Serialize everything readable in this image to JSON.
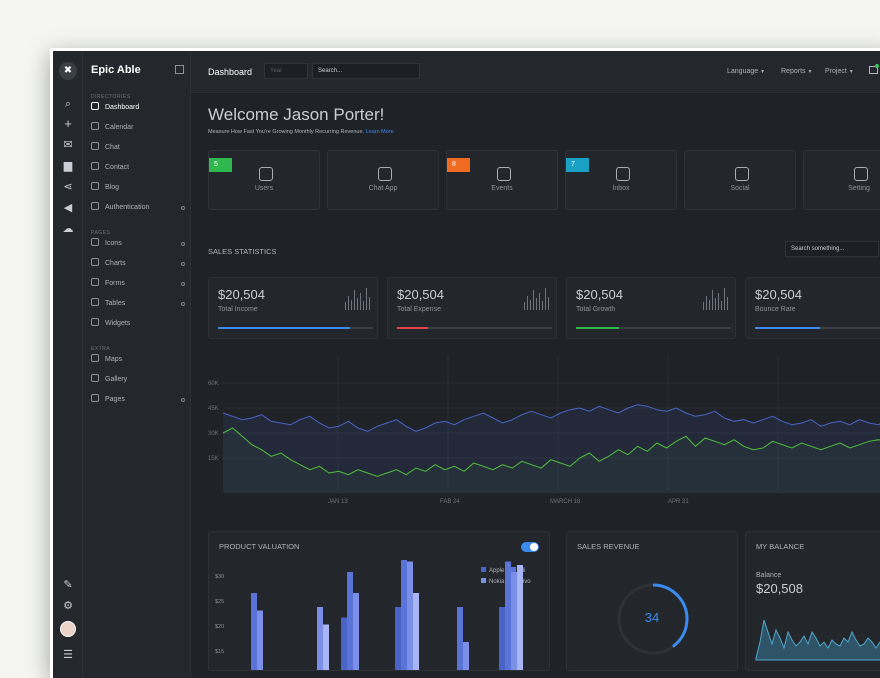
{
  "app": {
    "brand": "Epic Able"
  },
  "sidebar": {
    "sections": [
      {
        "title": "DIRECTORIES",
        "items": [
          {
            "label": "Dashboard",
            "active": true,
            "icon": "home-icon"
          },
          {
            "label": "Calendar",
            "icon": "calendar-icon"
          },
          {
            "label": "Chat",
            "icon": "chat-icon"
          },
          {
            "label": "Contact",
            "icon": "contact-icon"
          },
          {
            "label": "Blog",
            "icon": "globe-icon"
          },
          {
            "label": "Authentication",
            "icon": "lock-icon",
            "sub": true
          }
        ]
      },
      {
        "title": "PAGES",
        "items": [
          {
            "label": "Icons",
            "icon": "tag-icon",
            "sub": true
          },
          {
            "label": "Charts",
            "icon": "bar-chart-icon",
            "sub": true
          },
          {
            "label": "Forms",
            "icon": "forms-icon",
            "sub": true
          },
          {
            "label": "Tables",
            "icon": "table-icon",
            "sub": true
          },
          {
            "label": "Widgets",
            "icon": "widget-icon"
          }
        ]
      },
      {
        "title": "EXTRA",
        "items": [
          {
            "label": "Maps",
            "icon": "map-icon"
          },
          {
            "label": "Gallery",
            "icon": "image-icon"
          },
          {
            "label": "Pages",
            "icon": "page-icon",
            "sub": true
          }
        ]
      }
    ]
  },
  "topbar": {
    "title": "Dashboard",
    "year_placeholder": "Year",
    "search_value": "Search...",
    "menus": [
      "Language",
      "Reports",
      "Project"
    ]
  },
  "welcome": {
    "title": "Welcome Jason Porter!",
    "subtitle": "Measure How Fast You're Growing Monthly Recurring Revenue.",
    "link": "Learn More"
  },
  "cards": [
    {
      "label": "Users",
      "badge": "5",
      "badge_color": "#2fb84d",
      "icon": "users-icon"
    },
    {
      "label": "Chat App",
      "badge": "",
      "icon": "chat-icon"
    },
    {
      "label": "Events",
      "badge": "8",
      "badge_color": "#f06b22",
      "icon": "calendar-icon"
    },
    {
      "label": "Inbox",
      "badge": "7",
      "badge_color": "#19a2c4",
      "icon": "mail-icon"
    },
    {
      "label": "Social",
      "badge": "",
      "icon": "share-icon"
    },
    {
      "label": "Setting",
      "badge": "",
      "icon": "gear-icon"
    }
  ],
  "sales": {
    "heading": "SALES STATISTICS",
    "search_placeholder": "Search something...",
    "stats": [
      {
        "value": "$20,504",
        "label": "Total Income",
        "progress": 0.85,
        "color": "#3b8bef"
      },
      {
        "value": "$20,504",
        "label": "Total Expense",
        "progress": 0.2,
        "color": "#e8404b"
      },
      {
        "value": "$20,504",
        "label": "Total Growth",
        "progress": 0.28,
        "color": "#2fb84d"
      },
      {
        "value": "$20,504",
        "label": "Bounce Rate",
        "progress": 0.42,
        "color": "#3b8bef"
      }
    ]
  },
  "chart_data": [
    {
      "type": "area",
      "y_ticks": [
        "60K",
        "45K",
        "30K",
        "15K"
      ],
      "x_ticks": [
        "JAN 13",
        "FAB 24",
        "MARCH 18",
        "APR 31"
      ],
      "series": [
        {
          "color": "#4a63c7",
          "values": [
            42,
            40,
            38,
            39,
            41,
            37,
            36,
            35,
            38,
            40,
            36,
            33,
            34,
            37,
            33,
            31,
            34,
            36,
            38,
            34,
            31,
            33,
            36,
            37,
            35,
            38,
            40,
            42,
            39,
            36,
            38,
            41,
            43,
            41,
            39,
            42,
            44,
            45,
            43,
            46,
            44,
            42,
            45,
            47,
            46,
            44,
            43,
            45,
            42,
            40,
            41,
            43,
            39,
            37,
            38,
            36,
            38,
            40,
            37,
            35,
            36,
            38,
            34,
            36,
            37,
            35,
            38,
            36,
            35,
            39,
            40
          ]
        },
        {
          "color": "#4fbf3a",
          "values": [
            30,
            33,
            28,
            23,
            20,
            16,
            18,
            14,
            11,
            8,
            10,
            6,
            7,
            5,
            8,
            6,
            4,
            6,
            8,
            5,
            9,
            7,
            11,
            8,
            10,
            7,
            12,
            10,
            8,
            11,
            9,
            13,
            11,
            9,
            14,
            12,
            10,
            15,
            18,
            13,
            16,
            20,
            17,
            22,
            19,
            24,
            21,
            25,
            28,
            22,
            27,
            25,
            23,
            26,
            22,
            20,
            21,
            25,
            23,
            21,
            24,
            22,
            20,
            22,
            24,
            21,
            23,
            25,
            26,
            24,
            26
          ]
        }
      ]
    },
    {
      "type": "bar",
      "title": "PRODUCT VALUATION",
      "y_ticks": [
        "$30",
        "$25",
        "$20",
        "$15"
      ],
      "legend": [
        {
          "name": "Apple",
          "color": "#4a63c7"
        },
        {
          "name": "Mi",
          "color": "#5a73d6"
        },
        {
          "name": "Nokia",
          "color": "#7b8fe6"
        },
        {
          "name": "Vivo",
          "color": "#a8b5f2"
        }
      ],
      "groups": [
        [
          0,
          22,
          17,
          0
        ],
        [
          0,
          0,
          18,
          13
        ],
        [
          15,
          28,
          22,
          0
        ],
        [
          18,
          32,
          31,
          22
        ],
        [
          0,
          18,
          8,
          0
        ],
        [
          18,
          31,
          28,
          30
        ]
      ]
    }
  ],
  "revenue": {
    "heading": "SALES REVENUE",
    "value": "34",
    "percent": 0.4
  },
  "balance": {
    "heading": "MY BALANCE",
    "label": "Balance",
    "value": "$20,508"
  }
}
